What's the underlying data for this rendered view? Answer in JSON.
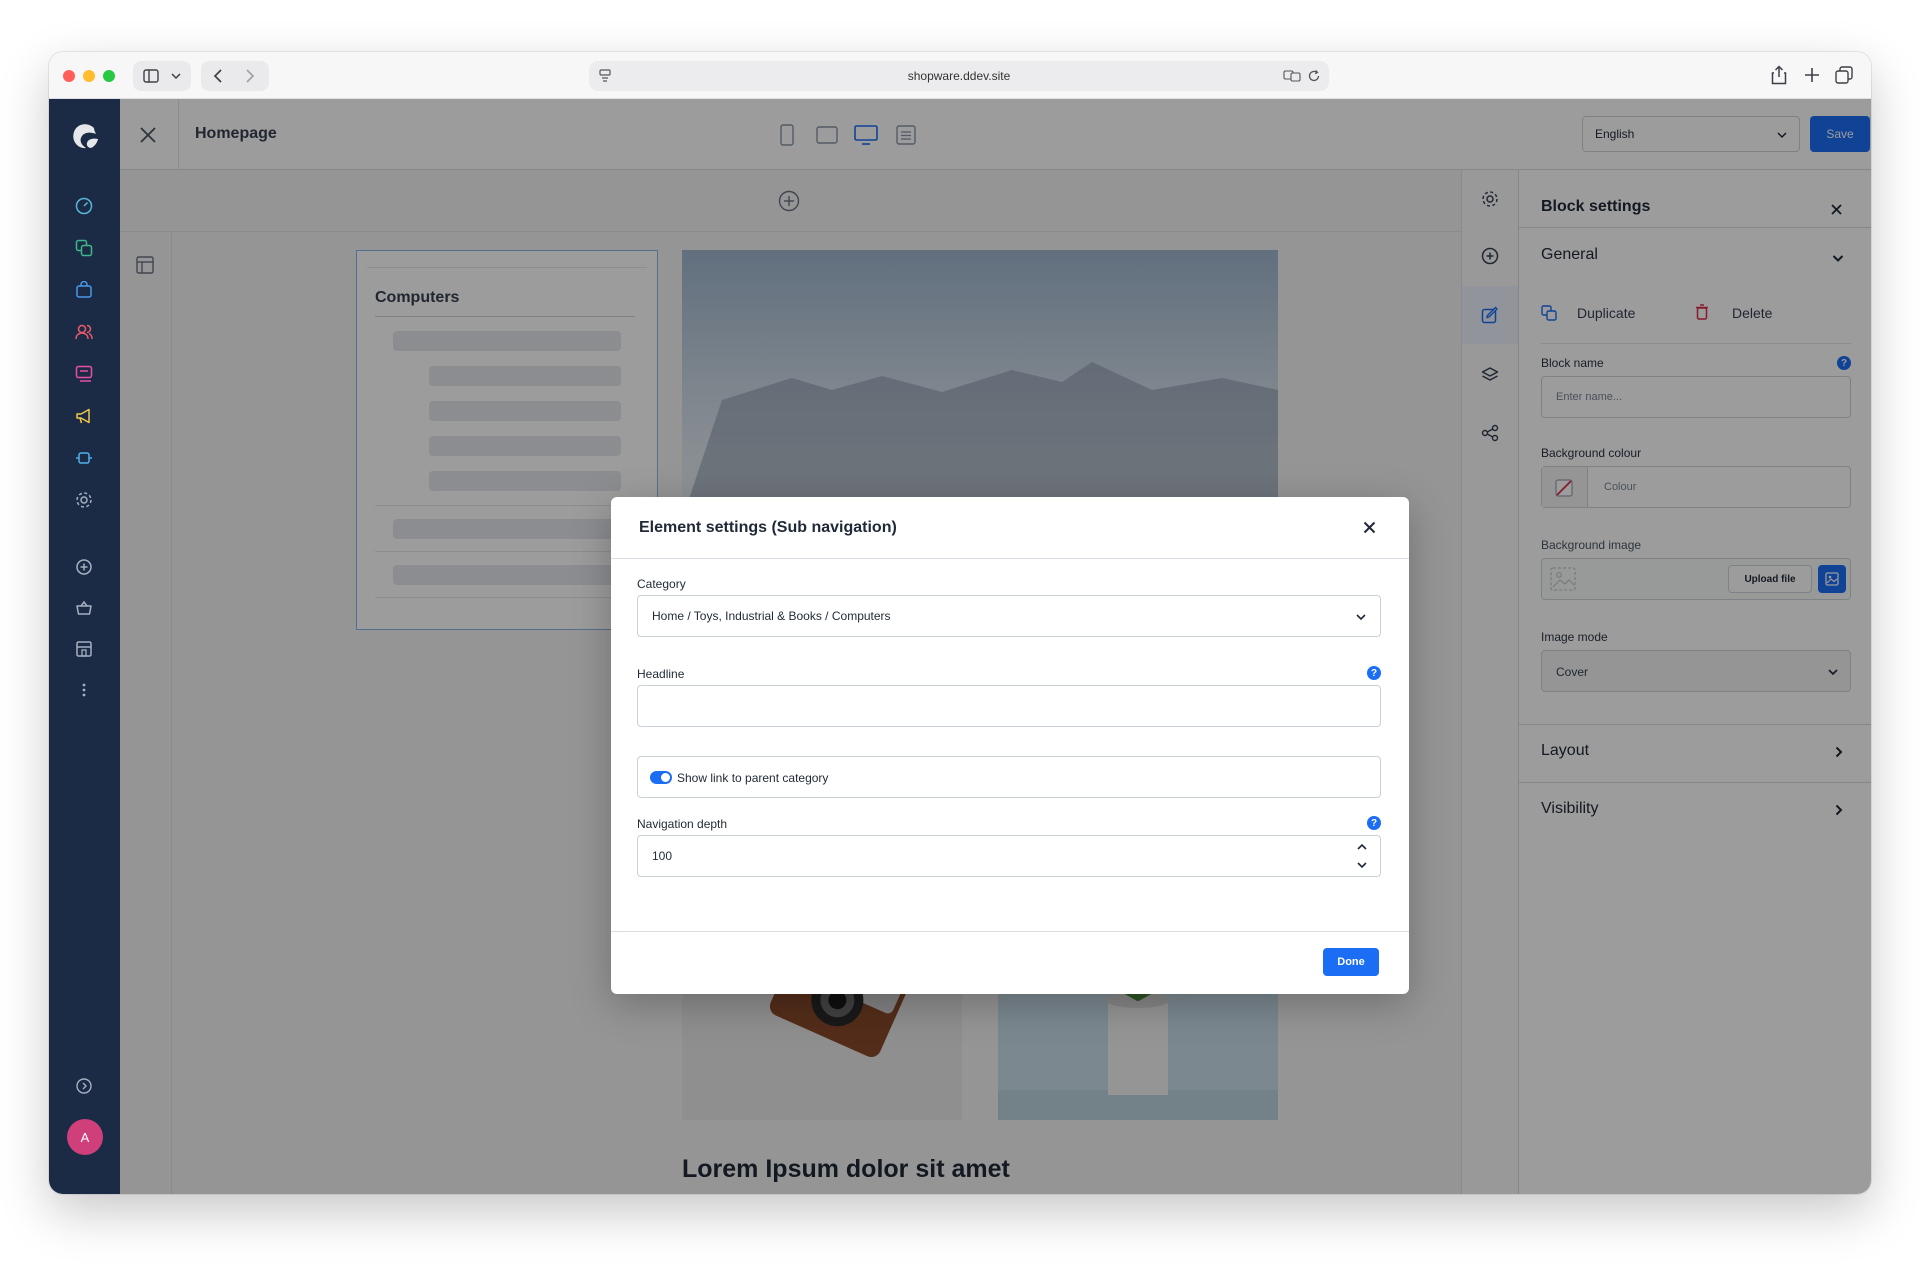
{
  "browser": {
    "url": "shopware.ddev.site"
  },
  "topbar": {
    "page_title": "Homepage",
    "language": "English",
    "save_label": "Save"
  },
  "user": {
    "avatar_initial": "A"
  },
  "stage": {
    "nav_card_title": "Computers",
    "bottom_headline": "Lorem Ipsum dolor sit amet"
  },
  "modal": {
    "title": "Element settings (Sub navigation)",
    "category_label": "Category",
    "category_value": "Home / Toys, Industrial & Books / Computers",
    "headline_label": "Headline",
    "headline_value": "",
    "toggle_label": "Show link to parent category",
    "toggle_on": true,
    "depth_label": "Navigation depth",
    "depth_value": "100",
    "done_label": "Done"
  },
  "panel": {
    "title": "Block settings",
    "general_label": "General",
    "duplicate_label": "Duplicate",
    "delete_label": "Delete",
    "block_name_label": "Block name",
    "block_name_placeholder": "Enter name...",
    "bg_colour_label": "Background colour",
    "bg_colour_placeholder": "Colour",
    "bg_image_label": "Background image",
    "upload_label": "Upload file",
    "image_mode_label": "Image mode",
    "image_mode_value": "Cover",
    "layout_label": "Layout",
    "visibility_label": "Visibility"
  },
  "colors": {
    "primary": "#1b6ef3",
    "sidebar": "#1b2b46",
    "toggle_on": "#1b6ef3"
  }
}
